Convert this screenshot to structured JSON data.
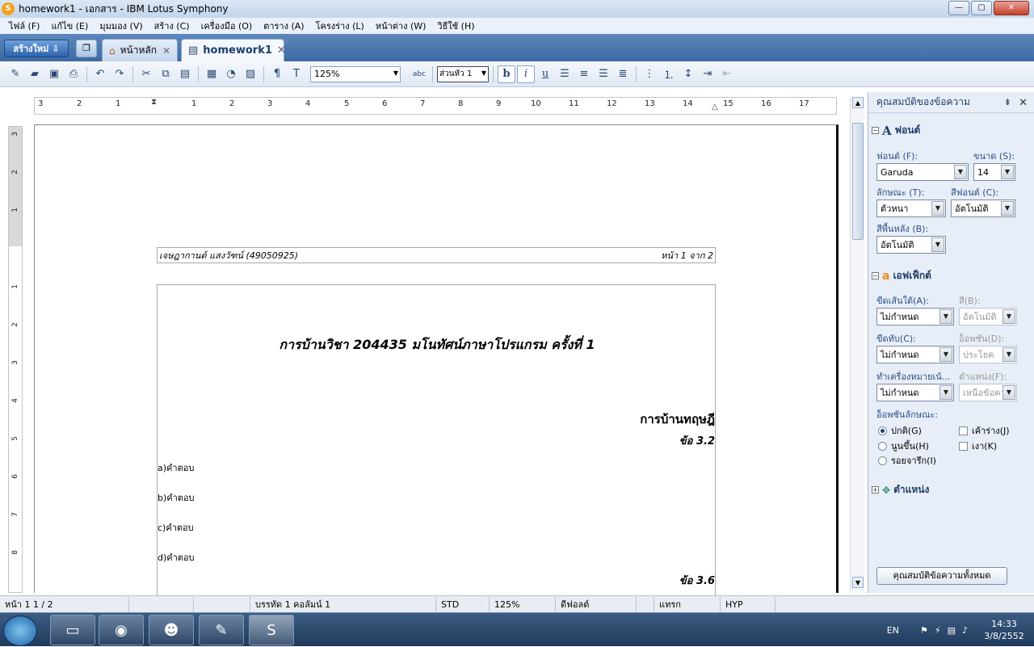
{
  "window": {
    "title": "homework1 - เอกสาร - IBM Lotus Symphony",
    "app_icon": "lotus-symphony-icon",
    "buttons": {
      "minimize": "—",
      "maximize": "▢",
      "close": "✕"
    }
  },
  "menu": [
    "ไฟล์ (F)",
    "แก้ไข (E)",
    "มุมมอง (V)",
    "สร้าง (C)",
    "เครื่องมือ (O)",
    "ตาราง (A)",
    "โครงร่าง (L)",
    "หน้าต่าง (W)",
    "วิธีใช้ (H)"
  ],
  "tabs": {
    "new_label": "สร้างใหม่",
    "home_label": "หน้าหลัก",
    "doc_label": "homework1",
    "close_glyph": "✕"
  },
  "toolbar": {
    "zoom": "125%",
    "style": "ส่วนหัว 1",
    "bold": "b",
    "italic": "i",
    "underline": "u"
  },
  "ruler": {
    "h_ticks": [
      "3",
      "2",
      "1",
      "1",
      "2",
      "3",
      "4",
      "5",
      "6",
      "7",
      "8",
      "9",
      "10",
      "11",
      "12",
      "13",
      "14",
      "15",
      "16",
      "17"
    ],
    "v_ticks": [
      "3",
      "2",
      "1",
      "1",
      "2",
      "3",
      "4",
      "5",
      "6",
      "7",
      "8"
    ]
  },
  "document": {
    "header_left": "เจษฎากานต์ แสงวัฑน์ (49050925)",
    "header_right": "หน้า 1 จาก 2",
    "title": "การบ้านวิชา 204435 มโนทัศน์ภาษาโปรแกรม ครั้งที่ 1",
    "heading": "การบ้านทฤษฎี",
    "q1": "ข้อ 3.2",
    "answers": [
      "a)คำตอบ",
      "b)คำตอบ",
      "c)คำตอบ",
      "d)คำตอบ"
    ],
    "q2": "ข้อ 3.6"
  },
  "panel": {
    "title": "คุณสมบัติของข้อความ",
    "font_section": "ฟอนต์",
    "font_label": "ฟอนต์ (F):",
    "font_value": "Garuda",
    "size_label": "ขนาด (S):",
    "size_value": "14",
    "style_label": "ลักษณะ (T):",
    "style_value": "ตัวหนา",
    "color_label": "สีฟอนต์ (C):",
    "color_value": "อัตโนมัติ",
    "bg_label": "สีพื้นหลัง (B):",
    "bg_value": "อัตโนมัติ",
    "effects_section": "เอฟเฟ็กต์",
    "underline_label": "ขีดเส้นใต้(A):",
    "underline_value": "ไม่กำหนด",
    "ucolor_label": "สี(B):",
    "ucolor_value": "อัตโนมัติ",
    "strike_label": "ขีดทับ(C):",
    "strike_value": "ไม่กำหนด",
    "strikeopt_label": "อ็อพชัน(D):",
    "strikeopt_value": "ประโยค",
    "emph_label": "ทำเครื่องหมายเน้...",
    "emph_value": "ไม่กำหนด",
    "pos_label": "ตำแหน่ง(F):",
    "pos_value": "เหนือข้อคว",
    "opt_label": "อ็อพชันลักษณะ:",
    "radio_normal": "ปกติ(G)",
    "radio_raised": "นูนขึ้น(H)",
    "radio_engraved": "รอยจารึก(I)",
    "check_outline": "เค้าร่าง(J)",
    "check_shadow": "เงา(K)",
    "position_section": "ตำแหน่ง",
    "all_button": "คุณสมบัติข้อความทั้งหมด"
  },
  "status": {
    "page": "หน้า 1  1 / 2",
    "line": "บรรทัด 1 คอลัมน์ 1",
    "mode": "STD",
    "zoom": "125%",
    "style": "ดีฟอลต์",
    "insert": "แทรก",
    "hyp": "HYP"
  },
  "taskbar": {
    "lang": "EN",
    "time": "14:33",
    "date": "3/8/2552"
  }
}
